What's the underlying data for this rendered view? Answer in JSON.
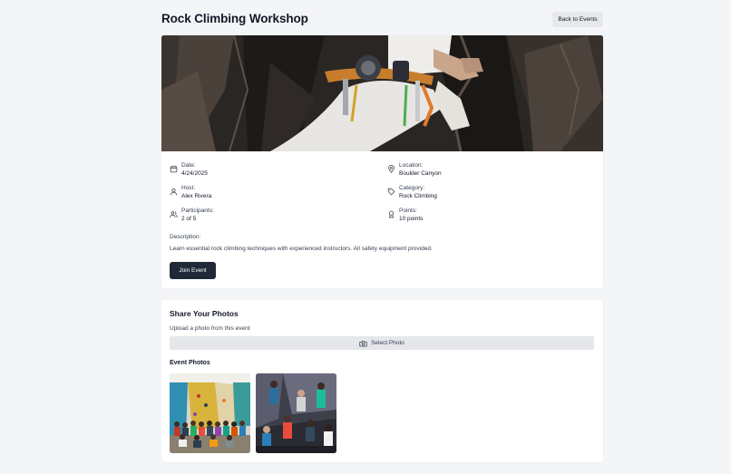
{
  "event": {
    "title": "Rock Climbing Workshop",
    "back_label": "Back to Events",
    "details": {
      "date_label": "Date:",
      "date_value": "4/24/2025",
      "location_label": "Location:",
      "location_value": "Boulder Canyon",
      "host_label": "Host:",
      "host_value": "Alex Rivera",
      "category_label": "Category:",
      "category_value": "Rock Climbing",
      "participants_label": "Participants:",
      "participants_value": "2 of 5",
      "points_label": "Points:",
      "points_value": "10 points"
    },
    "description_label": "Description:",
    "description_text": "Learn essential rock climbing techniques with experienced instructors. All safety equipment provided.",
    "join_label": "Join Event"
  },
  "photos": {
    "title": "Share Your Photos",
    "upload_hint": "Upload a photo from this event",
    "select_label": "Select Photo",
    "gallery_title": "Event Photos"
  },
  "icons": {
    "date": "calendar-icon",
    "location": "map-pin-icon",
    "host": "user-icon",
    "category": "tag-icon",
    "participants": "users-icon",
    "points": "award-icon",
    "select_photo": "camera-icon"
  },
  "colors": {
    "page_bg": "#f4f5f7",
    "card_bg": "#ffffff",
    "primary_button": "#1f2937",
    "secondary_button": "#e7e8ea"
  }
}
